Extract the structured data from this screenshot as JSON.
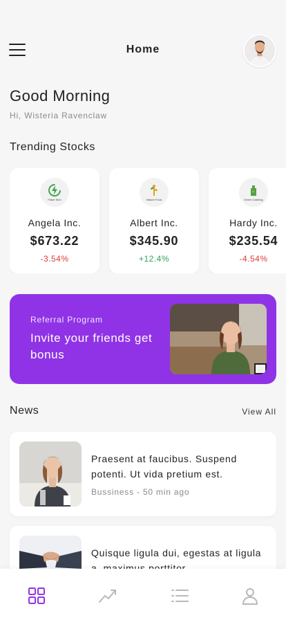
{
  "header": {
    "title": "Home",
    "menu_icon": "hamburger-menu-icon",
    "avatar": "user-avatar"
  },
  "greeting": {
    "title": "Good Morning",
    "subtitle": "Hi, Wisteria Ravenclaw"
  },
  "trending": {
    "title": "Trending Stocks",
    "stocks": [
      {
        "name": "Angela Inc.",
        "price": "$673.22",
        "change": "-3.54%",
        "trend": "down",
        "logo_text": "Flash Tech",
        "logo_icon": "lightning-bolt-icon",
        "color": "#3fa64b"
      },
      {
        "name": "Albert Inc.",
        "price": "$345.90",
        "change": "+12.4%",
        "trend": "up",
        "logo_text": "Nature Food",
        "logo_icon": "plant-icon",
        "color": "#e0a21a"
      },
      {
        "name": "Hardy Inc.",
        "price": "$235.54",
        "change": "-4.54%",
        "trend": "down",
        "logo_text": "Green Catering",
        "logo_icon": "green-bottle-icon",
        "color": "#4da34b"
      }
    ]
  },
  "referral": {
    "label": "Referral Program",
    "headline": "Invite your friends get bonus",
    "image": "woman-at-desk-photo",
    "background": "#9033e6"
  },
  "news": {
    "title": "News",
    "view_all": "View All",
    "items": [
      {
        "title": "Praesent at faucibus. Suspend potenti. Ut vida pretium est.",
        "meta": "Bussiness - 50 min ago",
        "image": "businesswoman-photo"
      },
      {
        "title": "Quisque ligula dui, egestas at ligula a, maximus porttitor.",
        "meta": "",
        "image": "handshake-photo"
      }
    ]
  },
  "tabbar": {
    "tabs": [
      {
        "icon": "dashboard-grid-icon",
        "active": true
      },
      {
        "icon": "trend-chart-icon",
        "active": false
      },
      {
        "icon": "list-icon",
        "active": false
      },
      {
        "icon": "profile-icon",
        "active": false
      }
    ],
    "active_color": "#9033e6",
    "inactive_color": "#b8b8bc"
  }
}
